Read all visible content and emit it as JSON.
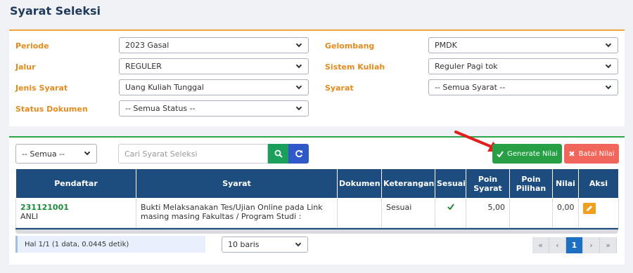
{
  "page": {
    "title": "Syarat Seleksi"
  },
  "filters": {
    "periode": {
      "label": "Periode",
      "value": "2023 Gasal"
    },
    "gelombang": {
      "label": "Gelombang",
      "value": "PMDK"
    },
    "jalur": {
      "label": "Jalur",
      "value": "REGULER"
    },
    "sistem_kuliah": {
      "label": "Sistem Kuliah",
      "value": "Reguler Pagi tok"
    },
    "jenis_syarat": {
      "label": "Jenis Syarat",
      "value": "Uang Kuliah Tunggal"
    },
    "syarat": {
      "label": "Syarat",
      "value": "-- Semua Syarat --"
    },
    "status_dokumen": {
      "label": "Status Dokumen",
      "value": "-- Semua Status --"
    }
  },
  "toolbar": {
    "filter_select": "-- Semua --",
    "search_placeholder": "Cari Syarat Seleksi",
    "search_icon": "search-icon",
    "refresh_icon": "refresh-icon",
    "generate_label": "Generate Nilai",
    "batal_label": "Batal Nilai",
    "colors": {
      "generate": "#27a045",
      "batal": "#f0665a",
      "search": "#1aa05a",
      "refresh": "#2f58c9"
    }
  },
  "table": {
    "headers": [
      "Pendaftar",
      "Syarat",
      "Dokumen",
      "Keterangan",
      "Sesuai",
      "Poin Syarat",
      "Poin Pilihan",
      "Nilai",
      "Aksi"
    ],
    "rows": [
      {
        "no_pendaftar": "231121001",
        "nama": "ANLI",
        "syarat": "Bukti Melaksanakan Tes/Ujian Online pada Link masing masing Fakultas / Program Studi :",
        "dokumen": "",
        "keterangan": "Sesuai",
        "sesuai_icon": "check-icon",
        "poin_syarat": "5,00",
        "poin_pilihan": "",
        "nilai": "0,00",
        "aksi_icon": "edit-icon"
      }
    ]
  },
  "footer": {
    "info": "Hal 1/1 (1 data, 0.0445 detik)",
    "per_page": "10 baris",
    "pager": {
      "first": "«",
      "prev": "‹",
      "current": "1",
      "next": "›",
      "last": "»"
    }
  }
}
